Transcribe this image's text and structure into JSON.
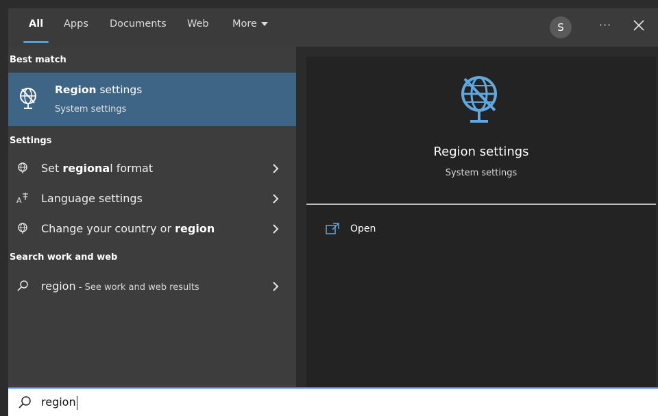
{
  "nav": {
    "tabs": [
      {
        "label": "All",
        "active": true
      },
      {
        "label": "Apps"
      },
      {
        "label": "Documents"
      },
      {
        "label": "Web"
      },
      {
        "label": "More"
      }
    ],
    "avatar_letter": "S",
    "more_options": "···"
  },
  "results": {
    "best_match_header": "Best match",
    "best_match": {
      "title_bold": "Region",
      "title_rest": " settings",
      "subtitle": "System settings",
      "icon": "globe-settings-icon"
    },
    "settings_header": "Settings",
    "settings_items": [
      {
        "pre": "Set ",
        "bold": "regiona",
        "post": "l format",
        "icon": "globe-icon"
      },
      {
        "pre": "Language settings",
        "bold": "",
        "post": "",
        "icon": "language-icon"
      },
      {
        "pre": "Change your country or ",
        "bold": "region",
        "post": "",
        "icon": "globe-icon"
      }
    ],
    "web_header": "Search work and web",
    "web_item": {
      "term": "region",
      "suffix": " - See work and web results",
      "icon": "search-icon"
    }
  },
  "preview": {
    "title": "Region settings",
    "subtitle": "System settings",
    "open_label": "Open",
    "accent": "#4ca0e0"
  },
  "search": {
    "value": "region"
  },
  "colors": {
    "selected_row": "#3e6585",
    "accent": "#3b8fd8",
    "icon_blue": "#5fa8e0"
  }
}
